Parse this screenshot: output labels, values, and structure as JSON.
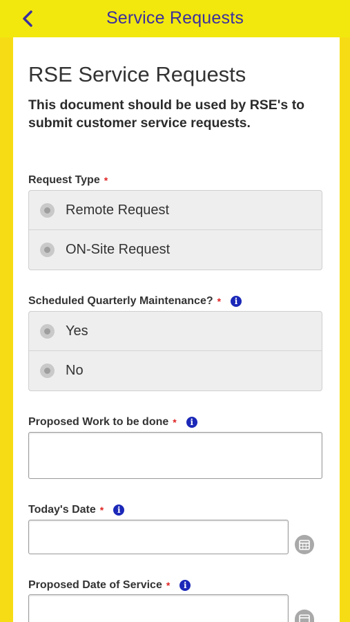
{
  "topbar": {
    "title": "Service Requests"
  },
  "form": {
    "title": "RSE Service Requests",
    "description": "This document should be used by RSE's to submit customer service requests."
  },
  "fields": {
    "request_type": {
      "label": "Request Type",
      "required_mark": "*",
      "options": [
        "Remote Request",
        "ON-Site Request"
      ]
    },
    "quarterly_maintenance": {
      "label": "Scheduled Quarterly Maintenance?",
      "required_mark": "*",
      "info": "i",
      "options": [
        "Yes",
        "No"
      ]
    },
    "proposed_work": {
      "label": "Proposed Work to be done",
      "required_mark": "*",
      "info": "i",
      "value": ""
    },
    "todays_date": {
      "label": "Today's Date",
      "required_mark": "*",
      "info": "i",
      "value": ""
    },
    "proposed_date": {
      "label": "Proposed Date of Service",
      "required_mark": "*",
      "info": "i",
      "value": ""
    }
  },
  "colors": {
    "header_background": "#f2e80e",
    "page_background": "#f6dc14",
    "title_text": "#3b2f9e",
    "required_star": "#e02424",
    "info_icon": "#1b28b8"
  }
}
